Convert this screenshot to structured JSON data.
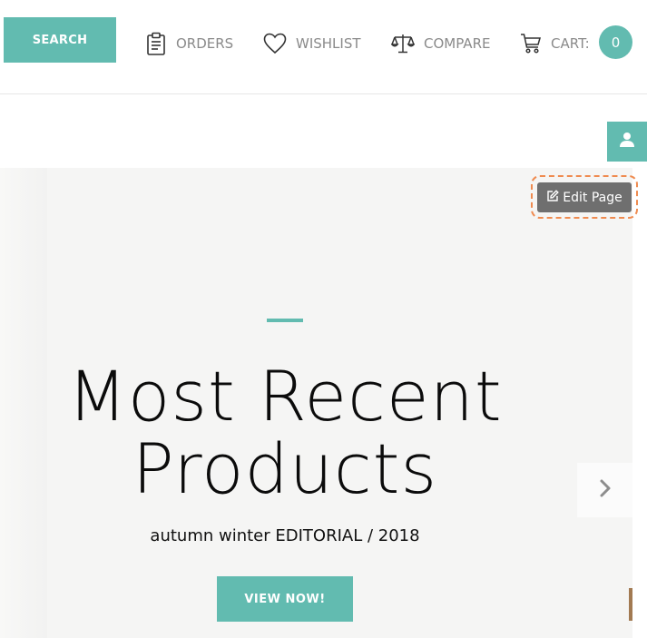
{
  "header": {
    "search_label": "SEARCH",
    "nav": {
      "orders": {
        "label": "ORDERS",
        "icon": "clipboard-icon"
      },
      "wishlist": {
        "label": "WISHLIST",
        "icon": "heart-icon"
      },
      "compare": {
        "label": "COMPARE",
        "icon": "balance-scale-icon"
      },
      "cart": {
        "label": "CART:",
        "icon": "cart-icon",
        "count": "0"
      }
    }
  },
  "account": {
    "icon": "user-icon"
  },
  "edit_page": {
    "label": "Edit Page",
    "icon": "edit-icon"
  },
  "hero": {
    "title_line1": "Most Recent",
    "title_line2": "Products",
    "subtitle": "autumn winter EDITORIAL / 2018",
    "cta_label": "VIEW NOW!",
    "next_icon": "chevron-right-icon"
  },
  "colors": {
    "accent": "#62bbb0",
    "hero_bg": "#f5f5f4",
    "edit_button": "#6f6f6f",
    "highlight": "#ef8b50"
  }
}
